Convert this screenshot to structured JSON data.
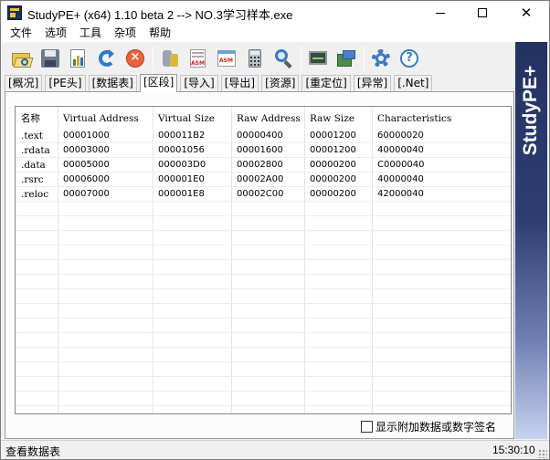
{
  "window": {
    "title": "StudyPE+ (x64) 1.10 beta 2  --> NO.3学习样本.exe",
    "minimize_label": "",
    "close_glyph": "✕"
  },
  "menu": [
    "文件",
    "选项",
    "工具",
    "杂项",
    "帮助"
  ],
  "toolbar": {
    "icons": [
      "open-file-icon",
      "save-icon",
      "report-icon",
      "refresh-icon",
      "stop-icon",
      "database-icon",
      "asm-icon",
      "asm-disassemble-icon",
      "calculator-icon",
      "search-icon",
      "screen-icon",
      "export-icon",
      "settings-gear-icon",
      "help-icon"
    ]
  },
  "tabs": [
    "[概况]",
    "[PE头]",
    "[数据表]",
    "[区段]",
    "[导入]",
    "[导出]",
    "[资源]",
    "[重定位]",
    "[异常]",
    "[.Net]"
  ],
  "active_tab_index": 3,
  "sections_table": {
    "columns": [
      "名称",
      "Virtual Address",
      "Virtual Size",
      "Raw Address",
      "Raw Size",
      "Characteristics"
    ],
    "rows": [
      [
        ".text",
        "00001000",
        "000011B2",
        "00000400",
        "00001200",
        "60000020"
      ],
      [
        ".rdata",
        "00003000",
        "00001056",
        "00001600",
        "00001200",
        "40000040"
      ],
      [
        ".data",
        "00005000",
        "000003D0",
        "00002800",
        "00000200",
        "C0000040"
      ],
      [
        ".rsrc",
        "00006000",
        "000001E0",
        "00002A00",
        "00000200",
        "40000040"
      ],
      [
        ".reloc",
        "00007000",
        "000001E8",
        "00002C00",
        "00000200",
        "42000040"
      ]
    ]
  },
  "checkbox": {
    "label": "显示附加数据或数字签名",
    "checked": false
  },
  "banner": {
    "text": "StudyPE+"
  },
  "status": {
    "left": "查看数据表",
    "time": "15:30:10"
  },
  "colors": {
    "banner_top": "#243261",
    "banner_bottom": "#c6d2ee",
    "grid_line": "#e3e3e3"
  }
}
